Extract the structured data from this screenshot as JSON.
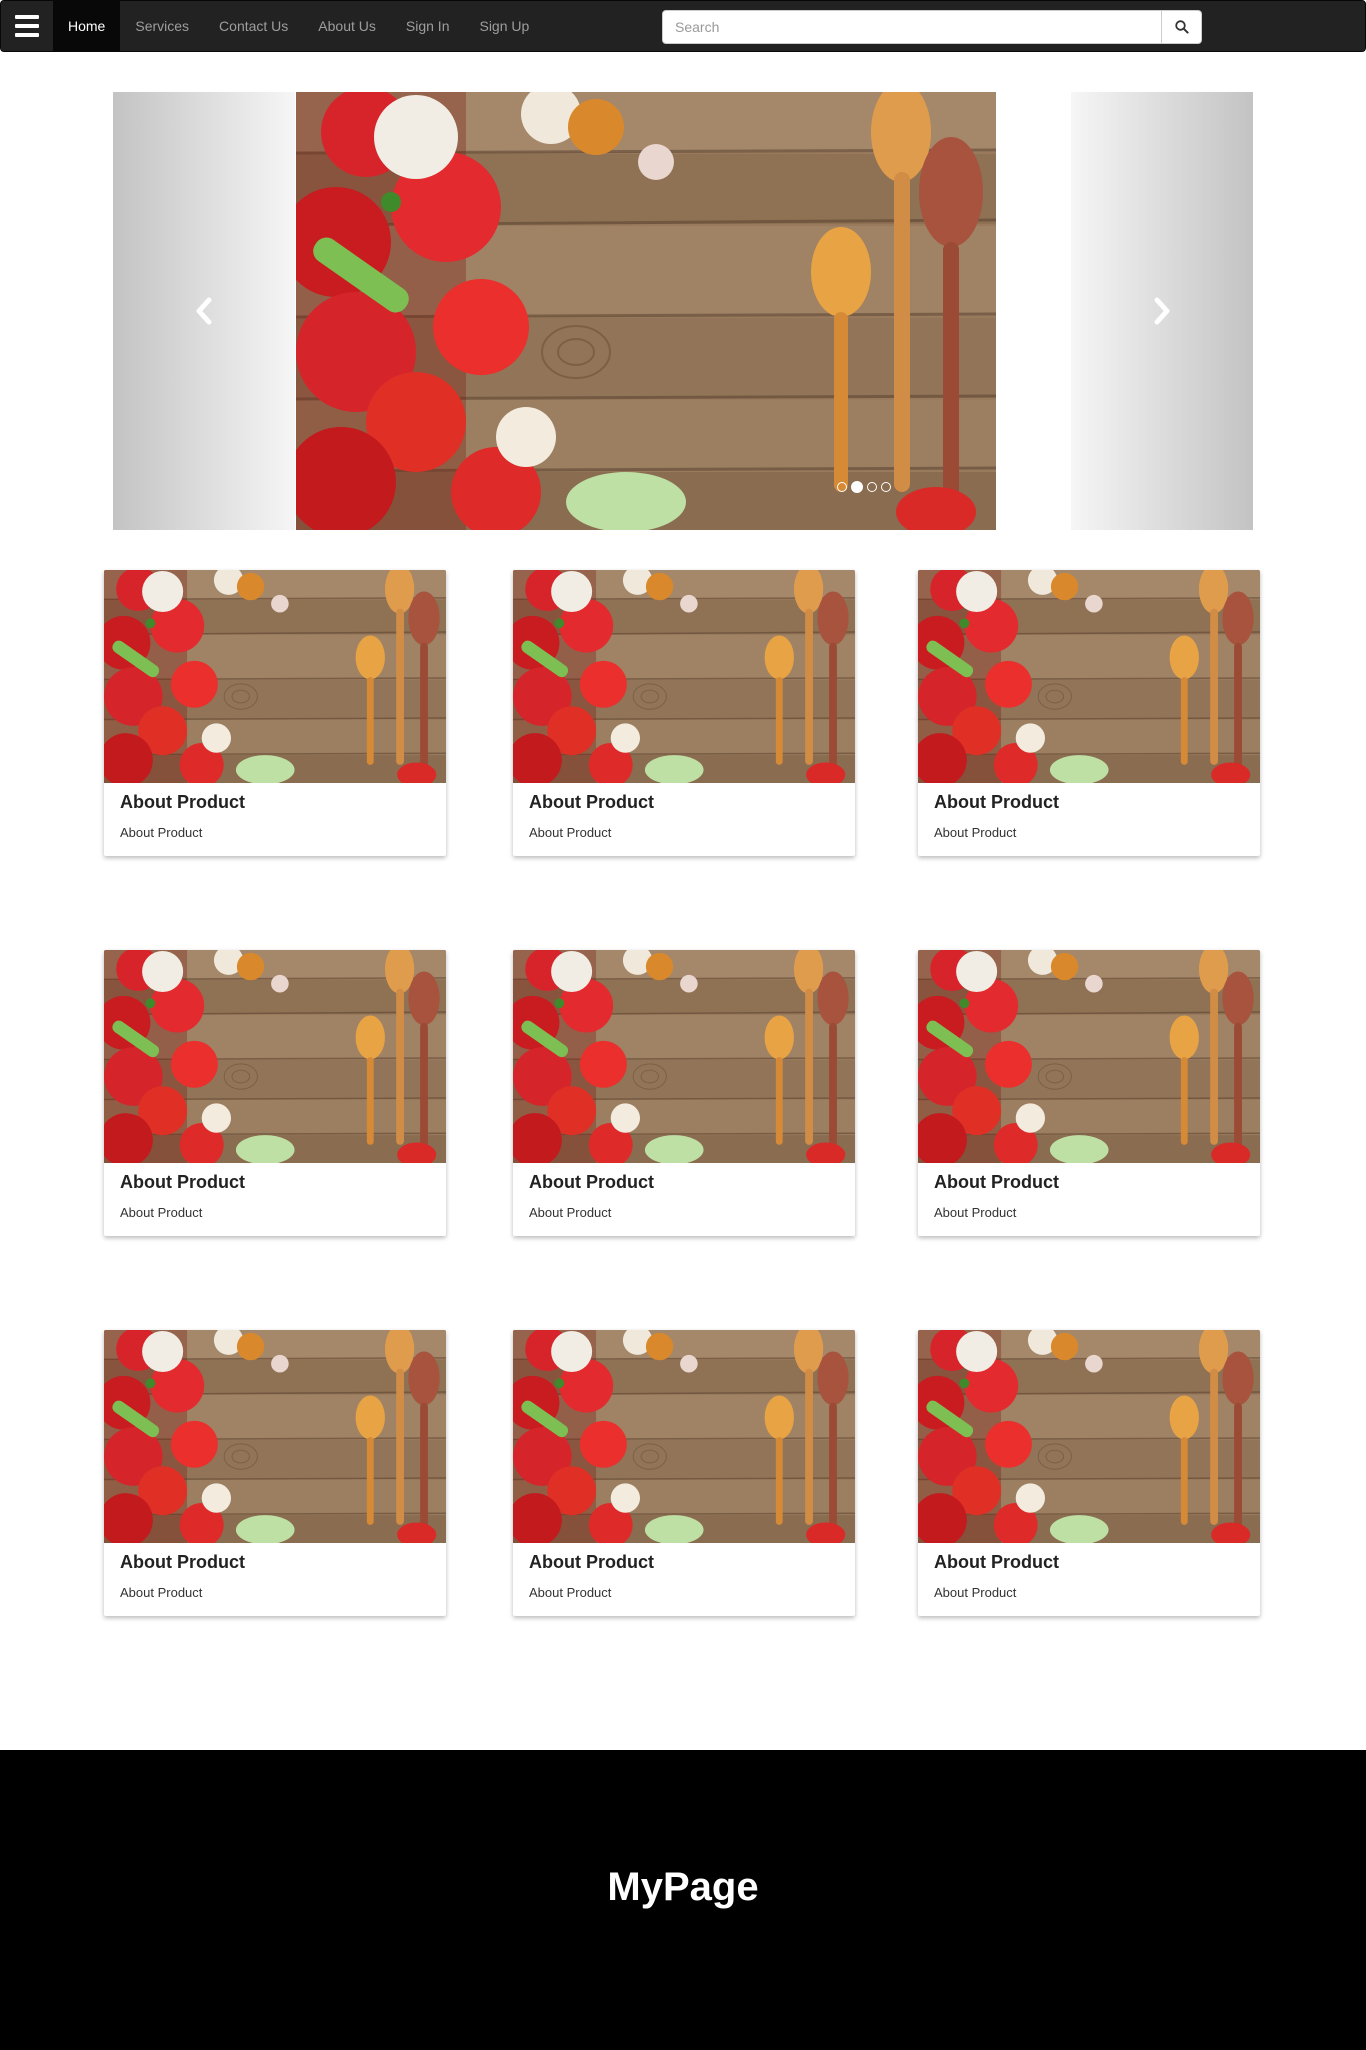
{
  "navbar": {
    "menu_icon": "hamburger-menu-icon",
    "links": [
      "Home",
      "Services",
      "Contact Us",
      "About Us",
      "Sign In",
      "Sign Up"
    ],
    "active_index": 0,
    "search": {
      "placeholder": "Search",
      "value": "",
      "icon": "search-icon"
    }
  },
  "carousel": {
    "image": "vegetables-and-wooden-spoons-photo",
    "prev_icon": "chevron-left-icon",
    "next_icon": "chevron-right-icon",
    "indicator_count": 4,
    "active_indicator": 1
  },
  "products": [
    {
      "title": "About Product",
      "text": "About Product"
    },
    {
      "title": "About Product",
      "text": "About Product"
    },
    {
      "title": "About Product",
      "text": "About Product"
    },
    {
      "title": "About Product",
      "text": "About Product"
    },
    {
      "title": "About Product",
      "text": "About Product"
    },
    {
      "title": "About Product",
      "text": "About Product"
    },
    {
      "title": "About Product",
      "text": "About Product"
    },
    {
      "title": "About Product",
      "text": "About Product"
    },
    {
      "title": "About Product",
      "text": "About Product"
    }
  ],
  "footer": {
    "title": "MyPage"
  },
  "colors": {
    "navbar_bg": "#222222",
    "active_link_bg": "#080808",
    "footer_bg": "#000000"
  }
}
